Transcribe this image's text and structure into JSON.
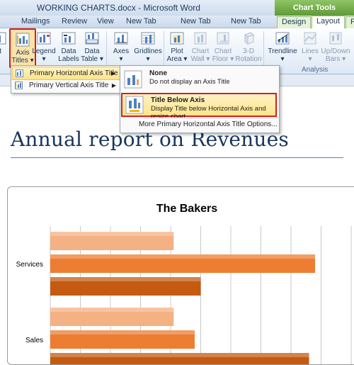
{
  "window": {
    "title": "WORKING CHARTS.docx - Microsoft Word",
    "contextual_tab_group": "Chart Tools"
  },
  "tabs": [
    "Mailings",
    "Review",
    "View",
    "New Tab",
    "New Tab",
    "New Tab",
    "Design",
    "Layout",
    "F"
  ],
  "ribbon": {
    "buttons": [
      {
        "label1": "rt",
        "label2": ""
      },
      {
        "label1": "Axis",
        "label2": "Titles ▾"
      },
      {
        "label1": "Legend",
        "label2": "▾"
      },
      {
        "label1": "Data",
        "label2": "Labels ▾"
      },
      {
        "label1": "Data",
        "label2": "Table ▾"
      },
      {
        "label1": "Axes",
        "label2": "▾"
      },
      {
        "label1": "Gridlines",
        "label2": "▾"
      },
      {
        "label1": "Plot",
        "label2": "Area ▾"
      },
      {
        "label1": "Chart",
        "label2": "Wall ▾"
      },
      {
        "label1": "Chart",
        "label2": "Floor ▾"
      },
      {
        "label1": "3-D",
        "label2": "Rotation"
      },
      {
        "label1": "Trendline",
        "label2": "▾"
      },
      {
        "label1": "Lines",
        "label2": "▾"
      },
      {
        "label1": "Up/Down",
        "label2": "Bars ▾"
      }
    ],
    "group_analysis": "Analysis"
  },
  "submenu": {
    "items": [
      {
        "label": "Primary Horizontal Axis Title",
        "arrow": "▶"
      },
      {
        "label": "Primary Vertical Axis Title",
        "arrow": "▶"
      }
    ]
  },
  "flyout": {
    "options": [
      {
        "heading": "None",
        "desc": "Do not display an Axis Title"
      },
      {
        "heading": "Title Below Axis",
        "desc": "Display Title below Horizontal Axis and resize chart"
      }
    ],
    "more": "More Primary Horizontal Axis Title Options..."
  },
  "document": {
    "heading": "Annual report on Revenues"
  },
  "chart_data": {
    "type": "bar",
    "orientation": "horizontal",
    "title": "The Bakers",
    "categories": [
      "Services",
      "Sales"
    ],
    "series": [
      {
        "color": "#f4b183",
        "values": [
          41,
          41
        ]
      },
      {
        "color": "#ed7d31",
        "values": [
          88,
          48
        ]
      },
      {
        "color": "#c55a11",
        "values": [
          50,
          86
        ]
      }
    ],
    "grid": true
  }
}
